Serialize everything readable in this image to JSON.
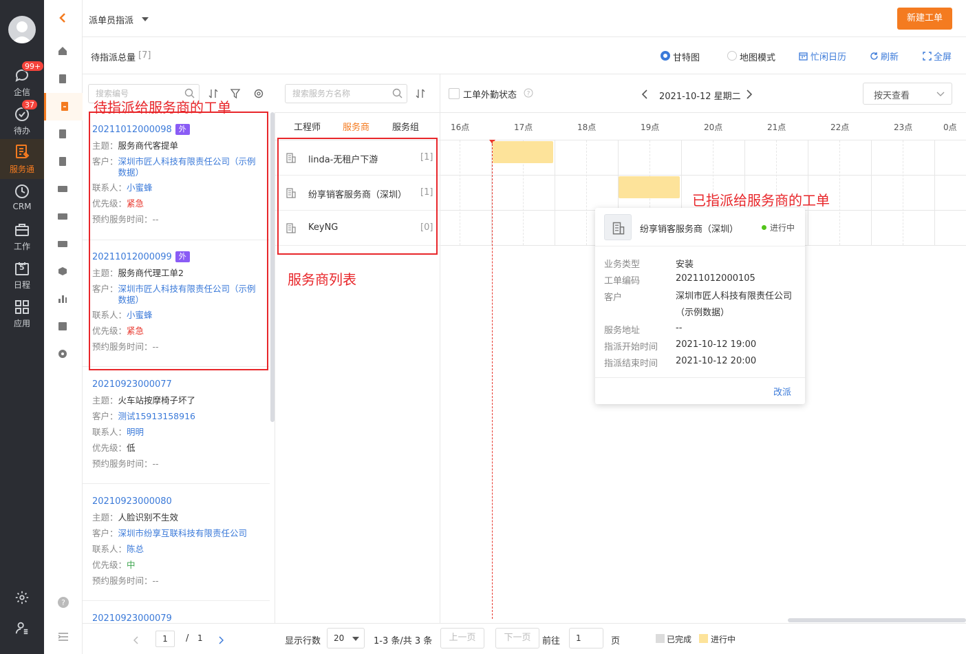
{
  "nav": {
    "items": [
      {
        "label": "企信",
        "badge": "99+",
        "icon": "chat-icon"
      },
      {
        "label": "待办",
        "badge": "37",
        "icon": "check-circle-icon"
      },
      {
        "label": "服务通",
        "icon": "service-icon",
        "active": true
      },
      {
        "label": "CRM",
        "icon": "clock-icon"
      },
      {
        "label": "工作",
        "icon": "briefcase-icon"
      },
      {
        "label": "日程",
        "icon": "calendar-icon",
        "date": "5"
      },
      {
        "label": "应用",
        "icon": "grid-icon"
      }
    ]
  },
  "header": {
    "title": "派单员指派",
    "new_button": "新建工单"
  },
  "subheader": {
    "pending_label": "待指派总量",
    "pending_count": "[7]",
    "view_gantt": "甘特图",
    "view_map": "地图模式",
    "calendar": "忙闲日历",
    "refresh": "刷新",
    "fullscreen": "全屏"
  },
  "ticket_search": {
    "placeholder": "搜索编号"
  },
  "provider_search": {
    "placeholder": "搜索服务方名称"
  },
  "gantt_toolbar": {
    "outside_status": "工单外勤状态",
    "date": "2021-10-12 星期二",
    "view_by": "按天查看"
  },
  "labels": {
    "subject": "主题：",
    "customer": "客户：",
    "contact": "联系人：",
    "priority": "优先级：",
    "appt": "预约服务时间：",
    "appt_value": "--"
  },
  "tickets": [
    {
      "no": "20211012000098",
      "tag": "外",
      "subject": "服务商代客提单",
      "customer": "深圳市匠人科技有限责任公司（示例数据）",
      "contact": "小蜜蜂",
      "priority": "紧急"
    },
    {
      "no": "20211012000099",
      "tag": "外",
      "subject": "服务商代理工单2",
      "customer": "深圳市匠人科技有限责任公司（示例数据）",
      "contact": "小蜜蜂",
      "priority": "紧急"
    },
    {
      "no": "20210923000077",
      "subject": "火车站按摩椅子坏了",
      "customer": "测试15913158916",
      "contact": "明明",
      "priority": "低"
    },
    {
      "no": "20210923000080",
      "subject": "人脸识别不生效",
      "customer": "深圳市纷享互联科技有限责任公司",
      "contact": "陈总",
      "priority": "中"
    },
    {
      "no": "20210923000079"
    }
  ],
  "list_pager": {
    "page": "1",
    "sep": "/",
    "total": "1"
  },
  "provider_tabs": [
    "工程师",
    "服务商",
    "服务组"
  ],
  "providers": [
    {
      "name": "linda-无租户下游",
      "count": "[1]"
    },
    {
      "name": "纷享销客服务商（深圳）",
      "count": "[1]"
    },
    {
      "name": "KeyNG",
      "count": "[0]"
    }
  ],
  "hours": [
    "16点",
    "17点",
    "18点",
    "19点",
    "20点",
    "21点",
    "22点",
    "23点",
    "0点"
  ],
  "popup": {
    "provider": "纷享销客服务商（深圳）",
    "status": "进行中",
    "status_color": "#52c41a",
    "fields": [
      {
        "k": "业务类型",
        "v": "安装"
      },
      {
        "k": "工单编码",
        "v": "20211012000105"
      },
      {
        "k": "客户",
        "v": "深圳市匠人科技有限责任公司（示例数据）"
      },
      {
        "k": "服务地址",
        "v": "--"
      },
      {
        "k": "指派开始时间",
        "v": "2021-10-12 19:00"
      },
      {
        "k": "指派结束时间",
        "v": "2021-10-12 20:00"
      }
    ],
    "action": "改派"
  },
  "annotations": {
    "pending": "待指派给服务商的工单",
    "providers": "服务商列表",
    "assigned": "已指派给服务商的工单"
  },
  "footer": {
    "rows_label": "显示行数",
    "rows_value": "20",
    "range": "1-3 条/共 3 条",
    "prev": "上一页",
    "next": "下一页",
    "goto": "前往",
    "goto_value": "1",
    "page_unit": "页",
    "legend_done": "已完成",
    "legend_progress": "进行中",
    "color_done": "#dcdcdc",
    "color_progress": "#fde39a"
  }
}
